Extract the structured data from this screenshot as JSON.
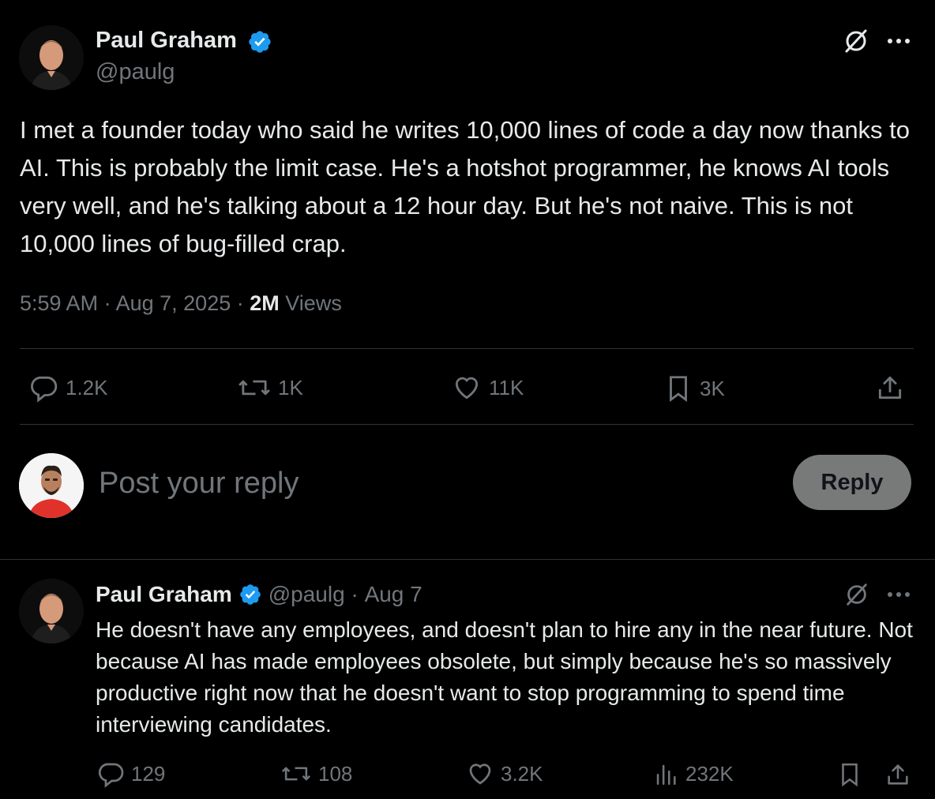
{
  "tweet": {
    "author_name": "Paul Graham",
    "author_handle": "@paulg",
    "text": "I met a founder today who said he writes 10,000 lines of code a day now thanks to AI. This is probably the limit case. He's a hotshot programmer, he knows AI tools very well, and he's talking about a 12 hour day. But he's not naive. This is not 10,000 lines of bug-filled crap.",
    "time": "5:59 AM",
    "date": "Aug 7, 2025",
    "views_count": "2M",
    "views_label": "Views",
    "stats": {
      "replies": "1.2K",
      "retweets": "1K",
      "likes": "11K",
      "bookmarks": "3K"
    }
  },
  "composer": {
    "placeholder": "Post your reply",
    "reply_label": "Reply"
  },
  "reply_tweet": {
    "author_name": "Paul Graham",
    "author_handle": "@paulg",
    "date": "Aug 7",
    "text": "He doesn't have any employees, and doesn't plan to hire any in the near future. Not because AI has made employees obsolete, but simply because he's so massively productive right now that he doesn't want to stop programming to spend time interviewing candidates.",
    "stats": {
      "replies": "129",
      "retweets": "108",
      "likes": "3.2K",
      "views": "232K"
    }
  },
  "colors": {
    "background": "#000000",
    "text": "#e7e9ea",
    "muted": "#71767b",
    "verified": "#1d9bf0",
    "divider": "#2f3336"
  }
}
